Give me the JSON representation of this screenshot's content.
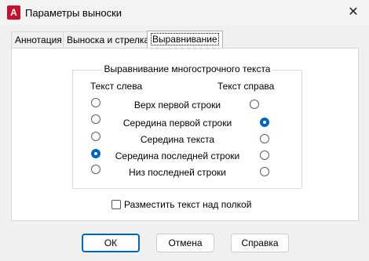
{
  "window": {
    "title": "Параметры выноски",
    "app_icon_letter": "A",
    "close_glyph": "✕"
  },
  "tabs": [
    {
      "label": "Аннотация",
      "active": false
    },
    {
      "label": "Выноска и стрелка",
      "active": false
    },
    {
      "label": "Выравнивание",
      "active": true
    }
  ],
  "alignment": {
    "group_title": "Выравнивание многострочного текста",
    "left_header": "Текст слева",
    "right_header": "Текст справа",
    "rows": [
      {
        "label": "Верх первой строки",
        "left_checked": false,
        "right_checked": false
      },
      {
        "label": "Середина первой строки",
        "left_checked": false,
        "right_checked": true
      },
      {
        "label": "Середина текста",
        "left_checked": false,
        "right_checked": false
      },
      {
        "label": "Середина последней строки",
        "left_checked": true,
        "right_checked": false
      },
      {
        "label": "Низ последней строки",
        "left_checked": false,
        "right_checked": false
      }
    ]
  },
  "underline_option": {
    "label": "Разместить текст над полкой",
    "checked": false
  },
  "buttons": {
    "ok": "ОК",
    "cancel": "Отмена",
    "help": "Справка"
  },
  "colors": {
    "accent": "#0067c0",
    "app_icon": "#c8102e"
  }
}
